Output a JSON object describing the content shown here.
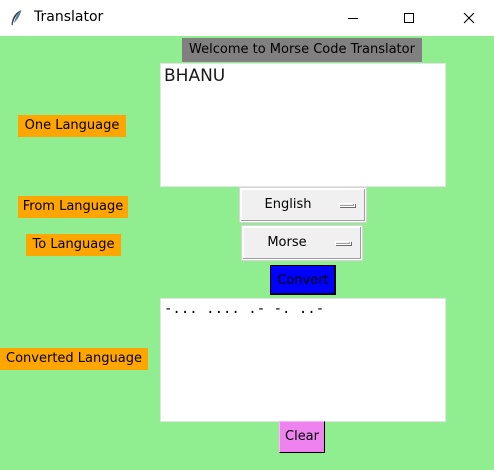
{
  "window": {
    "title": "Translator",
    "icon": "feather-icon",
    "controls": [
      "minimize-icon",
      "maximize-icon",
      "close-icon"
    ]
  },
  "header": {
    "welcome": "Welcome to Morse Code Translator"
  },
  "labels": {
    "one_language": "One Language",
    "from_language": "From Language",
    "to_language": "To Language",
    "converted_language": "Converted Language"
  },
  "input": {
    "value": "BHANU"
  },
  "from_select": {
    "selected": "English"
  },
  "to_select": {
    "selected": "Morse"
  },
  "buttons": {
    "convert": "Convert",
    "clear": "Clear"
  },
  "output": {
    "value": "-... .... .- -. ..-"
  },
  "colors": {
    "background": "#90ee90",
    "label_bg": "#ffa500",
    "header_bg": "#808080",
    "convert_bg": "#0000ff",
    "clear_bg": "#ee82ee"
  }
}
